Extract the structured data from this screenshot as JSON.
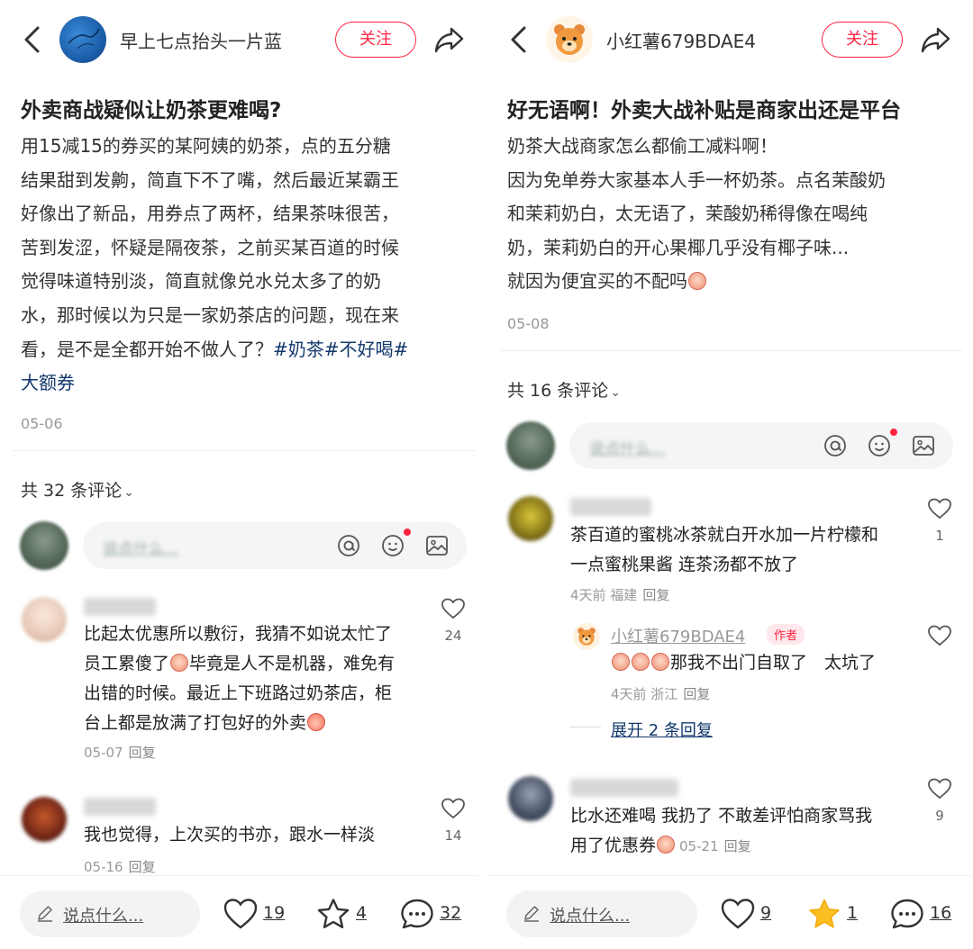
{
  "left": {
    "author_name": "早上七点抬头一片蓝",
    "follow_label": "关注",
    "title": "外卖商战疑似让奶茶更难喝?",
    "body_lines": [
      "用15减15的券买的某阿姨的奶茶，点的五分糖",
      "结果甜到发齁，简直下不了嘴，然后最近某霸王",
      "好像出了新品，用券点了两杯，结果茶味很苦，",
      "苦到发涩，怀疑是隔夜茶，之前买某百道的时候",
      "觉得味道特别淡，简直就像兑水兑太多了的奶",
      "水，那时候以为只是一家奶茶店的问题，现在来"
    ],
    "body_line7_text": "看，是不是全都开始不做人了？",
    "body_line7_tags": "#奶茶#不好喝#",
    "body_line8_tag": "大额券",
    "date": "05-06",
    "comment_count_label": "共 32 条评论",
    "comment_input_placeholder": "说点什么...",
    "comments": [
      {
        "text_1": "比起太优惠所以敷衍，我猜不如说太忙了",
        "text_2a": "员工累傻了",
        "text_2b": "毕竟是人不是机器，难免有",
        "text_3": "出错的时候。最近上下班路过奶茶店，柜",
        "text_4": "台上都是放满了打包好的外卖",
        "meta": "05-07",
        "reply": "回复",
        "likes": "24"
      },
      {
        "text_1": "我也觉得，上次买的书亦，跟水一样淡",
        "meta": "05-16",
        "reply": "回复",
        "likes": "14"
      }
    ],
    "bottom": {
      "placeholder": "说点什么...",
      "likes": "19",
      "stars": "4",
      "comments": "32"
    }
  },
  "right": {
    "author_name": "小红薯679BDAE4",
    "follow_label": "关注",
    "title": "好无语啊！外卖大战补贴是商家出还是平台",
    "body_lines": [
      "奶茶大战商家怎么都偷工减料啊！",
      "因为免单券大家基本人手一杯奶茶。点名茉酸奶",
      "和茉莉奶白，太无语了，茉酸奶稀得像在喝纯",
      "奶，茉莉奶白的开心果椰几乎没有椰子味..."
    ],
    "body_last": "就因为便宜买的不配吗",
    "date": "05-08",
    "comment_count_label": "共 16 条评论",
    "comment_input_placeholder": "说点什么...",
    "comments": [
      {
        "text_1": "茶百道的蜜桃冰茶就白开水加一片柠檬和",
        "text_2": "一点蜜桃果酱 连茶汤都不放了",
        "meta": "4天前 福建",
        "reply": "回复",
        "likes": "1"
      },
      {
        "text_1": "比水还难喝 我扔了 不敢差评怕商家骂我",
        "text_2a": "用了优惠券",
        "text_2b": "05-21",
        "reply": "回复",
        "likes": "9"
      }
    ],
    "author_reply": {
      "name": "小红薯679BDAE4",
      "badge": "作者",
      "text": "那我不出门自取了　太坑了",
      "meta": "4天前 浙江",
      "reply": "回复",
      "expand": "展开 2 条回复"
    },
    "bottom": {
      "placeholder": "说点什么...",
      "likes": "9",
      "stars": "1",
      "comments": "16"
    }
  },
  "colors": {
    "accent_red": "#ff2442",
    "tag_blue": "#13386c",
    "star_gold": "#fbbf24"
  },
  "icons": [
    "back-icon",
    "share-icon",
    "at-icon",
    "emoji-icon",
    "image-icon",
    "heart-icon",
    "star-icon",
    "comment-icon",
    "pencil-icon"
  ]
}
